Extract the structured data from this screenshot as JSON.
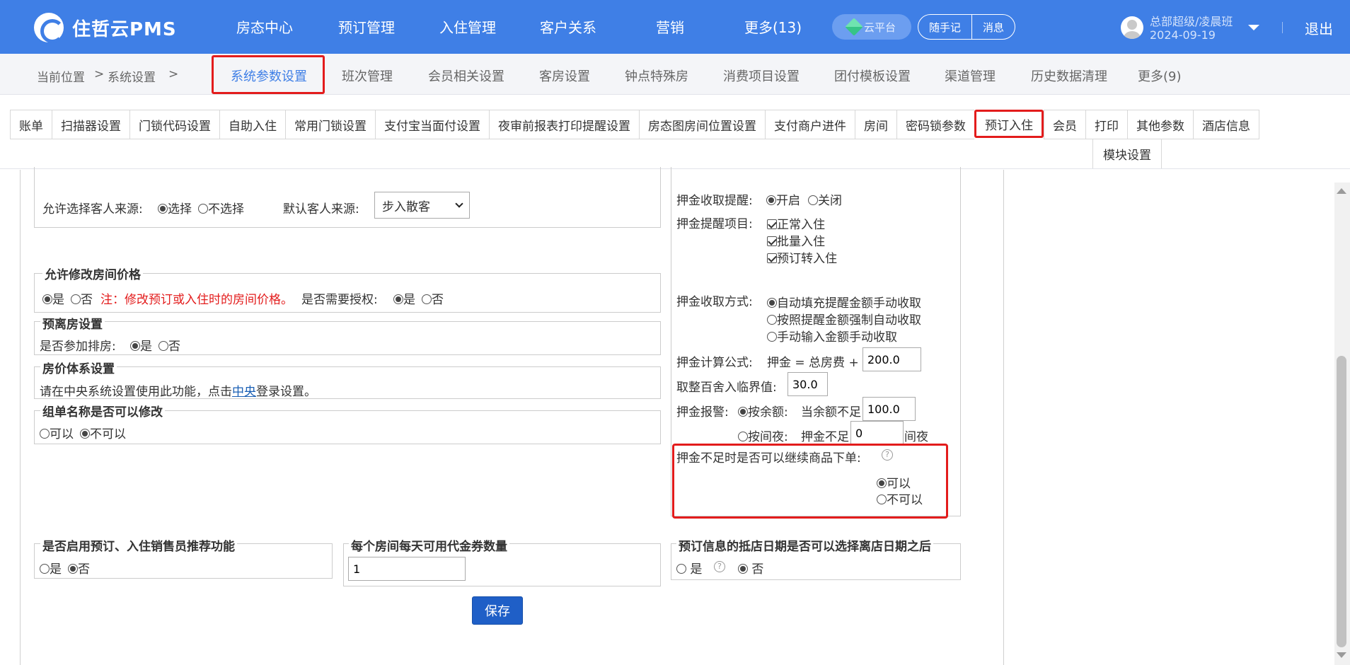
{
  "app": {
    "title": "住哲云PMS"
  },
  "nav": {
    "items": [
      "房态中心",
      "预订管理",
      "入住管理",
      "客户关系",
      "营销",
      "更多(13)"
    ],
    "cloud": "云平台",
    "memo": "随手记",
    "message": "消息"
  },
  "user": {
    "name": "总部超级/凌晨班",
    "date": "2024-09-19",
    "logout": "退出"
  },
  "breadcrumb": {
    "prefix": "当前位置",
    "sep": ">",
    "section": "系统设置"
  },
  "menu": {
    "items": [
      "系统参数设置",
      "班次管理",
      "会员相关设置",
      "客房设置",
      "钟点特殊房",
      "消费项目设置",
      "团付模板设置",
      "渠道管理",
      "历史数据清理",
      "更多(9)"
    ],
    "active_index": 0
  },
  "tabs": {
    "items": [
      "账单",
      "扫描器设置",
      "门锁代码设置",
      "自助入住",
      "常用门锁设置",
      "支付宝当面付设置",
      "夜审前报表打印提醒设置",
      "房态图房间位置设置",
      "支付商户进件",
      "房间",
      "密码锁参数",
      "预订入住",
      "会员",
      "打印",
      "其他参数",
      "酒店信息"
    ],
    "active": "预订入住",
    "row2": "模块设置"
  },
  "guest_source": {
    "allow_label": "允许选择客人来源:",
    "opt_select": "选择",
    "opt_noselect": "不选择",
    "allow_value": "选择",
    "default_label": "默认客人来源:",
    "default_value": "步入散客"
  },
  "price_modify": {
    "legend": "允许修改房间价格",
    "yes": "是",
    "no": "否",
    "value": "是",
    "note": "注：修改预订或入住时的房间价格。",
    "auth_label": "是否需要授权:",
    "auth_value": "是"
  },
  "pre_checkout": {
    "legend": "预离房设置",
    "label": "是否参加排房:",
    "yes": "是",
    "no": "否",
    "value": "是"
  },
  "price_system": {
    "legend": "房价体系设置",
    "text_before": "请在中央系统设置使用此功能，点击",
    "link": "中央",
    "text_after": "登录设置。"
  },
  "group_name": {
    "legend": "组单名称是否可以修改",
    "yes": "可以",
    "no": "不可以",
    "value": "不可以"
  },
  "deposit": {
    "remind_label": "押金收取提醒:",
    "on": "开启",
    "off": "关闭",
    "remind_value": "开启",
    "items_label": "押金提醒项目:",
    "items": [
      "正常入住",
      "批量入住",
      "预订转入住"
    ],
    "method_label": "押金收取方式:",
    "methods": [
      "自动填充提醒金额手动收取",
      "按照提醒金额强制自动收取",
      "手动输入金额手动收取"
    ],
    "method_value": "自动填充提醒金额手动收取",
    "formula_label": "押金计算公式:",
    "formula_text": "押金 = 总房费 +",
    "formula_value": "200.0",
    "round_label": "取整百舍入临界值:",
    "round_value": "30.0",
    "alarm_label": "押金报警:",
    "alarm_by_amount": "按余额:",
    "alarm_amount_text": "当余额不足",
    "alarm_amount_value": "100.0",
    "alarm_by_night": "按间夜:",
    "alarm_night_text": "押金不足",
    "alarm_night_value": "0",
    "alarm_night_unit": "间夜",
    "alarm_value": "按余额",
    "insufficient_label": "押金不足时是否可以继续商品下单:",
    "insufficient_yes": "可以",
    "insufficient_no": "不可以",
    "insufficient_value": "可以"
  },
  "sales_recommend": {
    "legend": "是否启用预订、入住销售员推荐功能",
    "yes": "是",
    "no": "否",
    "value": "否"
  },
  "voucher": {
    "legend": "每个房间每天可用代金券数量",
    "value": "1"
  },
  "arrival_date": {
    "legend": "预订信息的抵店日期是否可以选择离店日期之后",
    "yes": "是",
    "no": "否",
    "value": "否"
  },
  "save": {
    "label": "保存"
  }
}
